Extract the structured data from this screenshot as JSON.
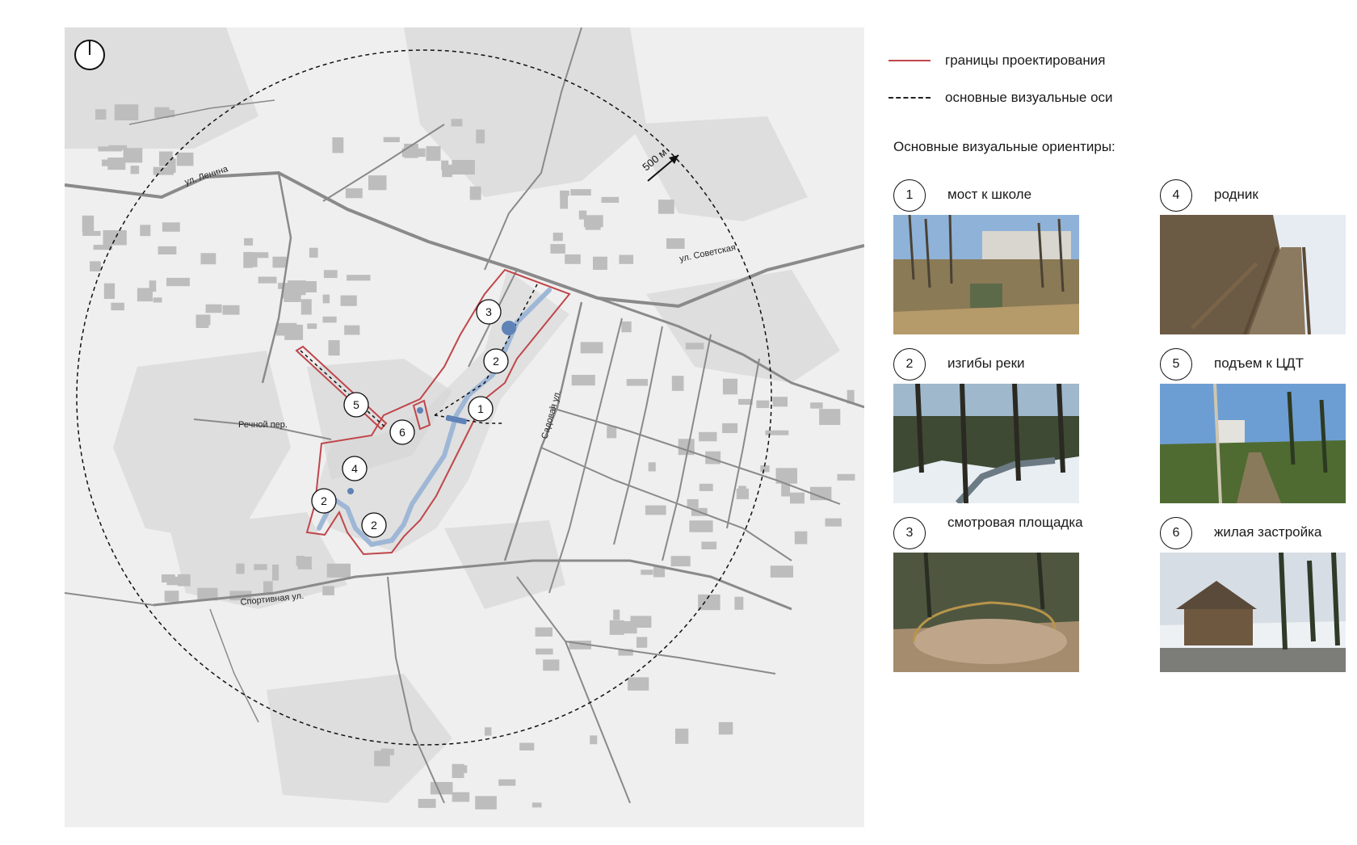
{
  "map": {
    "streets": {
      "lenina": "ул. Ленина",
      "sovetskaya": "ул. Советская",
      "sadovaya": "Садовая ул.",
      "rechnoy": "Речной пер.",
      "sportivnaya": "Спортивная ул."
    },
    "scale_label": "500 м",
    "markers": [
      "1",
      "2",
      "3",
      "4",
      "5",
      "6",
      "2",
      "2"
    ]
  },
  "legend": {
    "boundary_label": "границы проектирования",
    "axes_label": "основные визуальные оси",
    "landmarks_heading": "Основные визуальные ориентиры:"
  },
  "landmarks": [
    {
      "num": "1",
      "label": "мост к школе"
    },
    {
      "num": "2",
      "label": "изгибы реки"
    },
    {
      "num": "3",
      "label": "смотровая площадка"
    },
    {
      "num": "4",
      "label": "родник"
    },
    {
      "num": "5",
      "label": "подъем к ЦДТ"
    },
    {
      "num": "6",
      "label": "жилая застройка"
    }
  ],
  "colors": {
    "boundary": "#c0464b",
    "river": "#9fb7d6",
    "marker_blue": "#5f82b7",
    "road": "#8a8a8a",
    "building": "#bdbdbd"
  }
}
